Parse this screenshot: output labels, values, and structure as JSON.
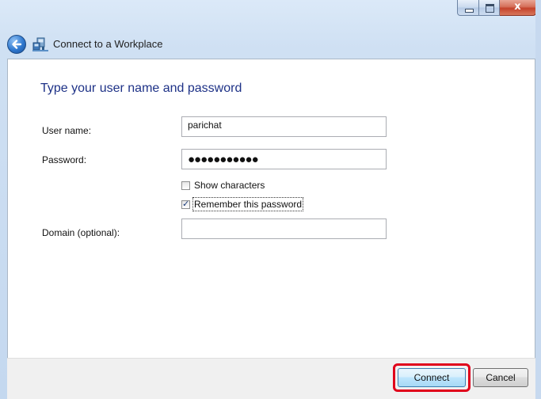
{
  "window": {
    "title": "Connect to a Workplace",
    "caption_buttons": {
      "minimize": "–",
      "maximize": "□",
      "close": "x"
    }
  },
  "page": {
    "heading": "Type your user name and password"
  },
  "form": {
    "username": {
      "label": "User name:",
      "value": "parichat"
    },
    "password": {
      "label": "Password:",
      "masked_value": "●●●●●●●●●●●"
    },
    "show_characters": {
      "label": "Show characters",
      "checked": false
    },
    "remember_password": {
      "label": "Remember this password",
      "checked": true,
      "check_glyph": "✓"
    },
    "domain": {
      "label": "Domain (optional):",
      "value": ""
    }
  },
  "footer": {
    "connect_label": "Connect",
    "cancel_label": "Cancel"
  },
  "colors": {
    "heading": "#1e3287",
    "highlight": "#e0001b",
    "chrome": "#c4d8ef"
  },
  "icons": {
    "back": "back-arrow-icon",
    "workplace": "workplace-network-icon"
  }
}
